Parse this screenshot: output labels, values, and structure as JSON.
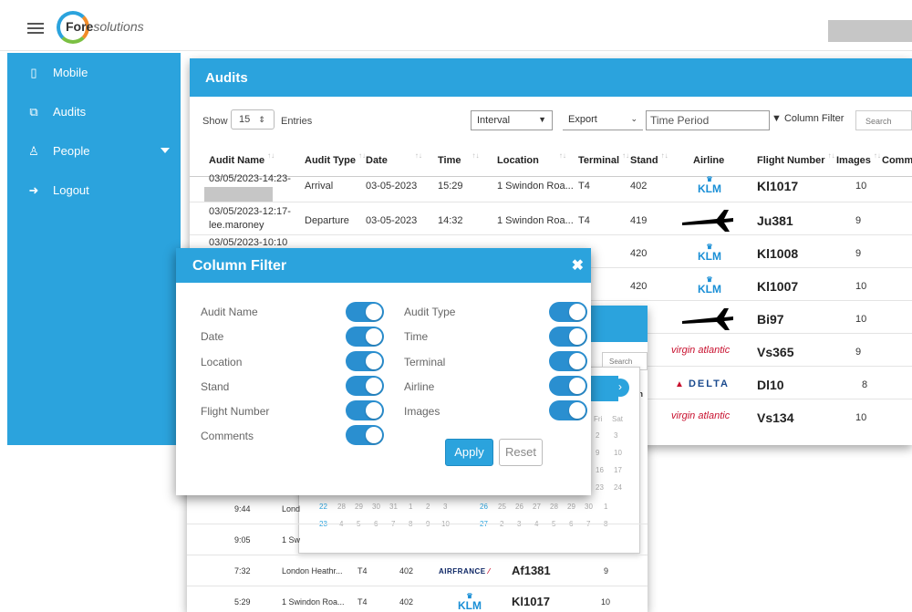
{
  "header": {
    "logo_main": "Fore",
    "logo_sub": "solutions"
  },
  "sidebar": {
    "items": [
      {
        "label": "Mobile",
        "icon": "mobile-icon"
      },
      {
        "label": "Audits",
        "icon": "audits-icon"
      },
      {
        "label": "People",
        "icon": "person-icon"
      },
      {
        "label": "Logout",
        "icon": "logout-icon"
      }
    ]
  },
  "audits": {
    "title": "Audits",
    "show_label": "Show",
    "entries_value": "15",
    "entries_label": "Entries",
    "interval": "Interval",
    "export": "Export",
    "time_period_placeholder": "Time Period",
    "column_filter": "Column Filter",
    "search_placeholder": "Search",
    "columns": [
      "Audit Name",
      "Audit Type",
      "Date",
      "Time",
      "Location",
      "Terminal",
      "Stand",
      "Airline",
      "Flight Number",
      "Images",
      "Comm"
    ],
    "rows": [
      {
        "name": "03/05/2023-14:23-",
        "name2": "",
        "type": "Arrival",
        "date": "03-05-2023",
        "time": "15:29",
        "location": "1 Swindon Roa...",
        "terminal": "T4",
        "stand": "402",
        "airline": "klm",
        "flight": "Kl1017",
        "images": "10"
      },
      {
        "name": "03/05/2023-12:17-",
        "name2": "lee.maroney",
        "type": "Departure",
        "date": "03-05-2023",
        "time": "14:32",
        "location": "1 Swindon Roa...",
        "terminal": "T4",
        "stand": "419",
        "airline": "plane",
        "flight": "Ju381",
        "images": "9"
      },
      {
        "name": "03/05/2023-10:10",
        "stand": "420",
        "airline": "klm",
        "flight": "Kl1008",
        "images": "9"
      },
      {
        "stand": "420",
        "airline": "klm",
        "flight": "Kl1007",
        "images": "10"
      },
      {
        "airline": "plane",
        "flight": "Bi97",
        "images": "10"
      },
      {
        "airline": "virgin",
        "flight": "Vs365",
        "images": "9"
      },
      {
        "airline": "delta",
        "flight": "Dl10",
        "images": "8"
      },
      {
        "airline": "virgin",
        "flight": "Vs134",
        "images": "10"
      }
    ]
  },
  "airline_text": {
    "klm": "KLM",
    "virgin": "virgin atlantic",
    "delta": "DELTA",
    "airfrance": "AIRFRANCE"
  },
  "background_table": {
    "search_placeholder": "Search",
    "m": "m",
    "cal_days_header": [
      "Fri",
      "Sat"
    ],
    "cal_right_col": [
      [
        "2",
        "3"
      ],
      [
        "9",
        "10"
      ],
      [
        "16",
        "17"
      ],
      [
        "23",
        "24"
      ]
    ],
    "cal_row1_left": [
      "22",
      "28",
      "29",
      "30",
      "31",
      "1",
      "2",
      "3"
    ],
    "cal_row1_right": [
      "26",
      "25",
      "26",
      "27",
      "28",
      "29",
      "30",
      "1"
    ],
    "cal_row2_left": [
      "23",
      "4",
      "5",
      "6",
      "7",
      "8",
      "9",
      "10"
    ],
    "cal_row2_right": [
      "27",
      "2",
      "3",
      "4",
      "5",
      "6",
      "7",
      "8"
    ],
    "rows": [
      {
        "time": "9:44",
        "location": "Lond"
      },
      {
        "time": "9:05",
        "location": "1 Sw"
      },
      {
        "time": "7:32",
        "location": "London Heathr...",
        "terminal": "T4",
        "stand": "402",
        "airline": "airfrance",
        "flight": "Af1381",
        "images": "9"
      },
      {
        "time": "5:29",
        "location": "1 Swindon Roa...",
        "terminal": "T4",
        "stand": "402",
        "airline": "klm",
        "flight": "Kl1017",
        "images": "10"
      }
    ]
  },
  "column_filter_modal": {
    "title": "Column Filter",
    "close": "✖",
    "left": [
      "Audit Name",
      "Date",
      "Location",
      "Stand",
      "Flight Number",
      "Comments"
    ],
    "right": [
      "Audit Type",
      "Time",
      "Terminal",
      "Airline",
      "Images"
    ],
    "apply": "Apply",
    "reset": "Reset"
  }
}
